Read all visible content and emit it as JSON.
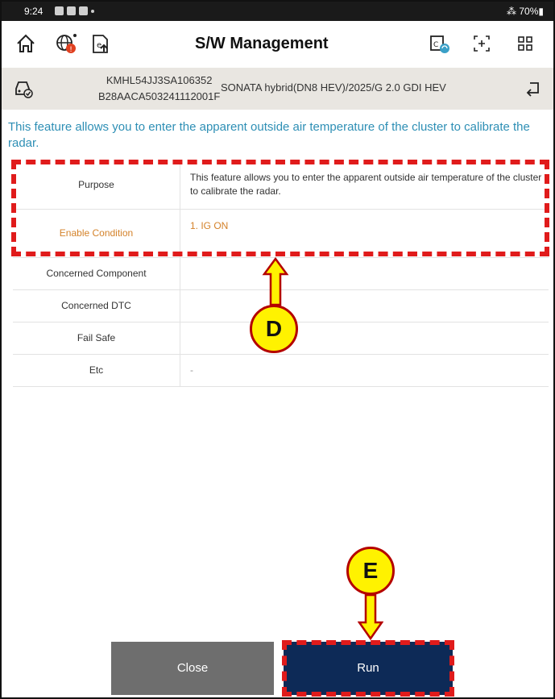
{
  "status": {
    "time": "9:24",
    "battery": "70%"
  },
  "header": {
    "title": "S/W Management"
  },
  "vehicle": {
    "vin": "KMHL54JJ3SA106352",
    "code": "B28AACA503241112001F",
    "model": "SONATA hybrid(DN8 HEV)/2025/G 2.0 GDI HEV"
  },
  "description": "This feature allows you to enter the apparent outside air temperature of the cluster to calibrate the radar.",
  "rows": [
    {
      "label": "Purpose",
      "value": "This feature allows you to enter the apparent outside air temperature of the cluster to calibrate the radar."
    },
    {
      "label": "Enable Condition",
      "value": "1. IG ON"
    },
    {
      "label": "Concerned Component",
      "value": ""
    },
    {
      "label": "Concerned DTC",
      "value": ""
    },
    {
      "label": "Fail Safe",
      "value": ""
    },
    {
      "label": "Etc",
      "value": "-"
    }
  ],
  "annotations": {
    "d": "D",
    "e": "E"
  },
  "buttons": {
    "close": "Close",
    "run": "Run"
  },
  "colors": {
    "accent": "#2e8fb5",
    "run": "#0d2a57",
    "close": "#6e6e6e",
    "annotation": "#e01b1b",
    "marker": "#fff200"
  }
}
